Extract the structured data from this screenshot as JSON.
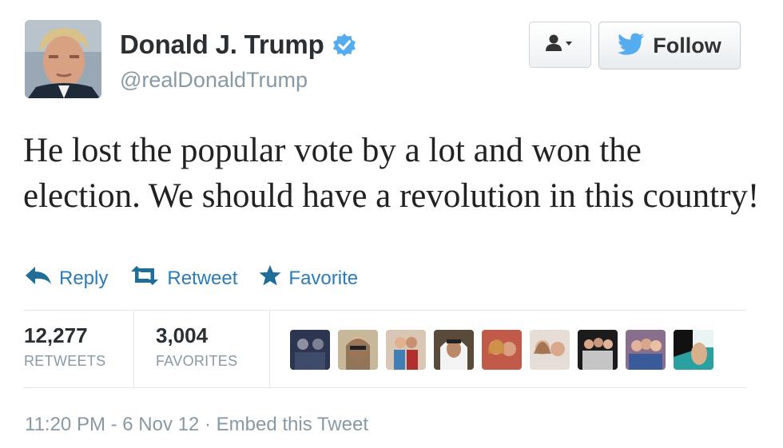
{
  "author": {
    "name": "Donald J. Trump",
    "handle": "@realDonaldTrump",
    "verified": true
  },
  "header_buttons": {
    "user_menu_icon": "person-dropdown-icon",
    "follow_label": "Follow",
    "follow_icon": "twitter-bird-icon"
  },
  "tweet": {
    "text": "He lost the popular vote by a lot and won the election. We should have a revolution in this country!"
  },
  "actions": {
    "reply": "Reply",
    "retweet": "Retweet",
    "favorite": "Favorite"
  },
  "stats": {
    "retweets_count": "12,277",
    "retweets_label": "RETWEETS",
    "favorites_count": "3,004",
    "favorites_label": "FAVORITES"
  },
  "favoriters_count": 9,
  "meta": {
    "timestamp": "11:20 PM - 6 Nov 12",
    "separator": " · ",
    "embed": "Embed this Tweet"
  },
  "colors": {
    "link_blue": "#2b7bb9",
    "verified_blue": "#55acee",
    "muted": "#8899a6",
    "text": "#292f33"
  }
}
